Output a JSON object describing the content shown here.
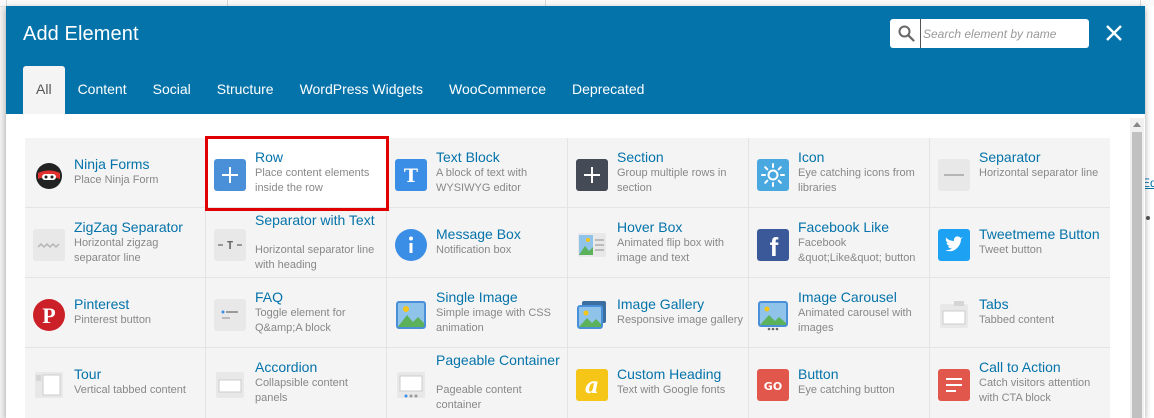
{
  "modal": {
    "title": "Add Element",
    "search": {
      "placeholder": "Search element by name",
      "value": ""
    }
  },
  "tabs": [
    {
      "label": "All",
      "active": true
    },
    {
      "label": "Content"
    },
    {
      "label": "Social"
    },
    {
      "label": "Structure"
    },
    {
      "label": "WordPress Widgets"
    },
    {
      "label": "WooCommerce"
    },
    {
      "label": "Deprecated"
    }
  ],
  "elements": [
    {
      "name": "Ninja Forms",
      "desc": "Place Ninja Form",
      "icon": "ninja-icon",
      "color": "#ffffff"
    },
    {
      "name": "Row",
      "desc": "Place content elements inside the row",
      "icon": "plus-icon",
      "color": "#4a90d9"
    },
    {
      "name": "Text Block",
      "desc": "A block of text with WYSIWYG editor",
      "icon": "text-icon",
      "color": "#3a8ee6"
    },
    {
      "name": "Section",
      "desc": "Group multiple rows in section",
      "icon": "plus-icon",
      "color": "#444a56"
    },
    {
      "name": "Icon",
      "desc": "Eye catching icons from libraries",
      "icon": "sun-icon",
      "color": "#4aa8e0"
    },
    {
      "name": "Separator",
      "desc": "Horizontal separator line",
      "icon": "separator-icon",
      "color": "#e8e8e8"
    },
    {
      "name": "ZigZag Separator",
      "desc": "Horizontal zigzag separator line",
      "icon": "zigzag-icon",
      "color": "#e8e8e8"
    },
    {
      "name": "Separator with Text",
      "desc": "Horizontal separator line with heading",
      "icon": "separator-text-icon",
      "color": "#e8e8e8"
    },
    {
      "name": "Message Box",
      "desc": "Notification box",
      "icon": "info-icon",
      "color": "#3a8ee6"
    },
    {
      "name": "Hover Box",
      "desc": "Animated flip box with image and text",
      "icon": "hover-box-icon",
      "color": "#e8e8e8"
    },
    {
      "name": "Facebook Like",
      "desc": "Facebook &quot;Like&quot; button",
      "icon": "facebook-icon",
      "color": "#3b5998"
    },
    {
      "name": "Tweetmeme Button",
      "desc": "Tweet button",
      "icon": "twitter-icon",
      "color": "#1da1f2"
    },
    {
      "name": "Pinterest",
      "desc": "Pinterest button",
      "icon": "pinterest-icon",
      "color": "#cb2027"
    },
    {
      "name": "FAQ",
      "desc": "Toggle element for Q&amp;A block",
      "icon": "faq-icon",
      "color": "#e8e8e8"
    },
    {
      "name": "Single Image",
      "desc": "Simple image with CSS animation",
      "icon": "image-icon",
      "color": "#4a90d9"
    },
    {
      "name": "Image Gallery",
      "desc": "Responsive image gallery",
      "icon": "gallery-icon",
      "color": "#4a90d9"
    },
    {
      "name": "Image Carousel",
      "desc": "Animated carousel with images",
      "icon": "carousel-icon",
      "color": "#4a90d9"
    },
    {
      "name": "Tabs",
      "desc": "Tabbed content",
      "icon": "tabs-icon",
      "color": "#e8e8e8"
    },
    {
      "name": "Tour",
      "desc": "Vertical tabbed content",
      "icon": "tour-icon",
      "color": "#e8e8e8"
    },
    {
      "name": "Accordion",
      "desc": "Collapsible content panels",
      "icon": "accordion-icon",
      "color": "#e8e8e8"
    },
    {
      "name": "Pageable Container",
      "desc": "Pageable content container",
      "icon": "pageable-icon",
      "color": "#e8e8e8"
    },
    {
      "name": "Custom Heading",
      "desc": "Text with Google fonts",
      "icon": "heading-icon",
      "color": "#f5c518"
    },
    {
      "name": "Button",
      "desc": "Eye catching button",
      "icon": "button-go-icon",
      "color": "#e2574c"
    },
    {
      "name": "Call to Action",
      "desc": "Catch visitors attention with CTA block",
      "icon": "cta-icon",
      "color": "#e2574c"
    }
  ],
  "background": {
    "edge_link": "Ed"
  }
}
